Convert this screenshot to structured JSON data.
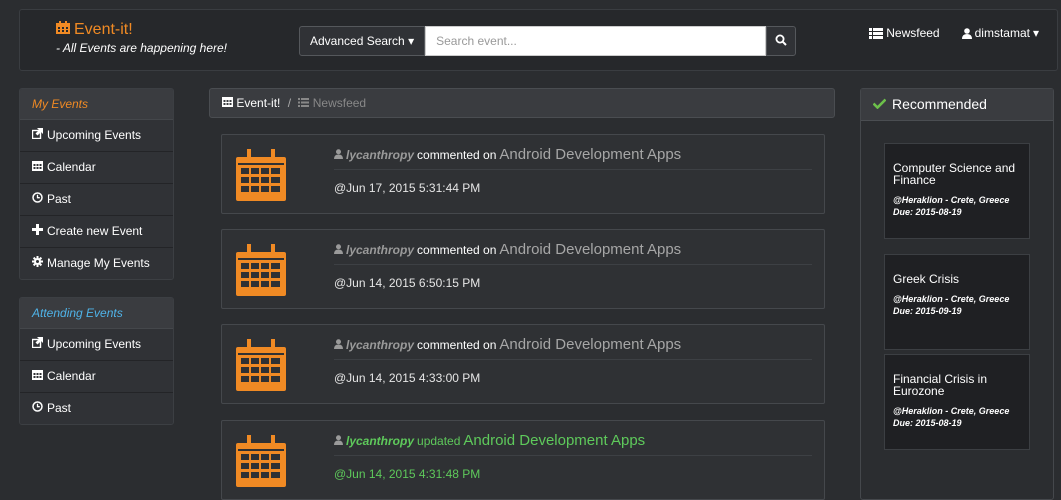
{
  "brand": {
    "title": "Event-it!",
    "subtitle": "- All Events are happening here!",
    "color": "#f08a24"
  },
  "search": {
    "advanced_label": "Advanced Search",
    "placeholder": "Search event..."
  },
  "nav": {
    "newsfeed_label": "Newsfeed",
    "user_label": "dimstamat"
  },
  "sidebar": {
    "my_events": {
      "header": "My Events",
      "header_color": "#f08a24",
      "items": [
        {
          "icon": "external-link-icon",
          "label": "Upcoming Events"
        },
        {
          "icon": "calendar-icon",
          "label": "Calendar"
        },
        {
          "icon": "clock-icon",
          "label": "Past"
        },
        {
          "icon": "plus-icon",
          "label": "Create new Event"
        },
        {
          "icon": "gear-icon",
          "label": "Manage My Events"
        }
      ]
    },
    "attending_events": {
      "header": "Attending Events",
      "header_color": "#4fb3e8",
      "items": [
        {
          "icon": "external-link-icon",
          "label": "Upcoming Events"
        },
        {
          "icon": "calendar-icon",
          "label": "Calendar"
        },
        {
          "icon": "clock-icon",
          "label": "Past"
        }
      ]
    }
  },
  "breadcrumb": {
    "root": "Event-it!",
    "separator": "/",
    "current": "Newsfeed"
  },
  "feed": [
    {
      "user": "lycanthropy",
      "action": "commented on",
      "event": "Android Development Apps",
      "date": "@Jun 17, 2015 5:31:44 PM",
      "style": "normal"
    },
    {
      "user": "lycanthropy",
      "action": "commented on",
      "event": "Android Development Apps",
      "date": "@Jun 14, 2015 6:50:15 PM",
      "style": "normal"
    },
    {
      "user": "lycanthropy",
      "action": "commented on",
      "event": "Android Development Apps",
      "date": "@Jun 14, 2015 4:33:00 PM",
      "style": "normal"
    },
    {
      "user": "lycanthropy",
      "action": "updated",
      "event": "Android Development Apps",
      "date": "@Jun 14, 2015 4:31:48 PM",
      "style": "green"
    }
  ],
  "recommended": {
    "header": "Recommended",
    "items": [
      {
        "title": "Computer Science and Finance",
        "location": "@Heraklion - Crete, Greece",
        "due": "Due: 2015-08-19"
      },
      {
        "title": "Greek Crisis",
        "location": "@Heraklion - Crete, Greece",
        "due": "Due: 2015-09-19"
      },
      {
        "title": "Financial Crisis in Eurozone",
        "location": "@Heraklion - Crete, Greece",
        "due": "Due: 2015-08-19"
      }
    ]
  },
  "colors": {
    "accent_orange": "#f08a24",
    "accent_blue": "#4fb3e8",
    "accent_green": "#5ec95b",
    "check_green": "#6cc04a"
  }
}
